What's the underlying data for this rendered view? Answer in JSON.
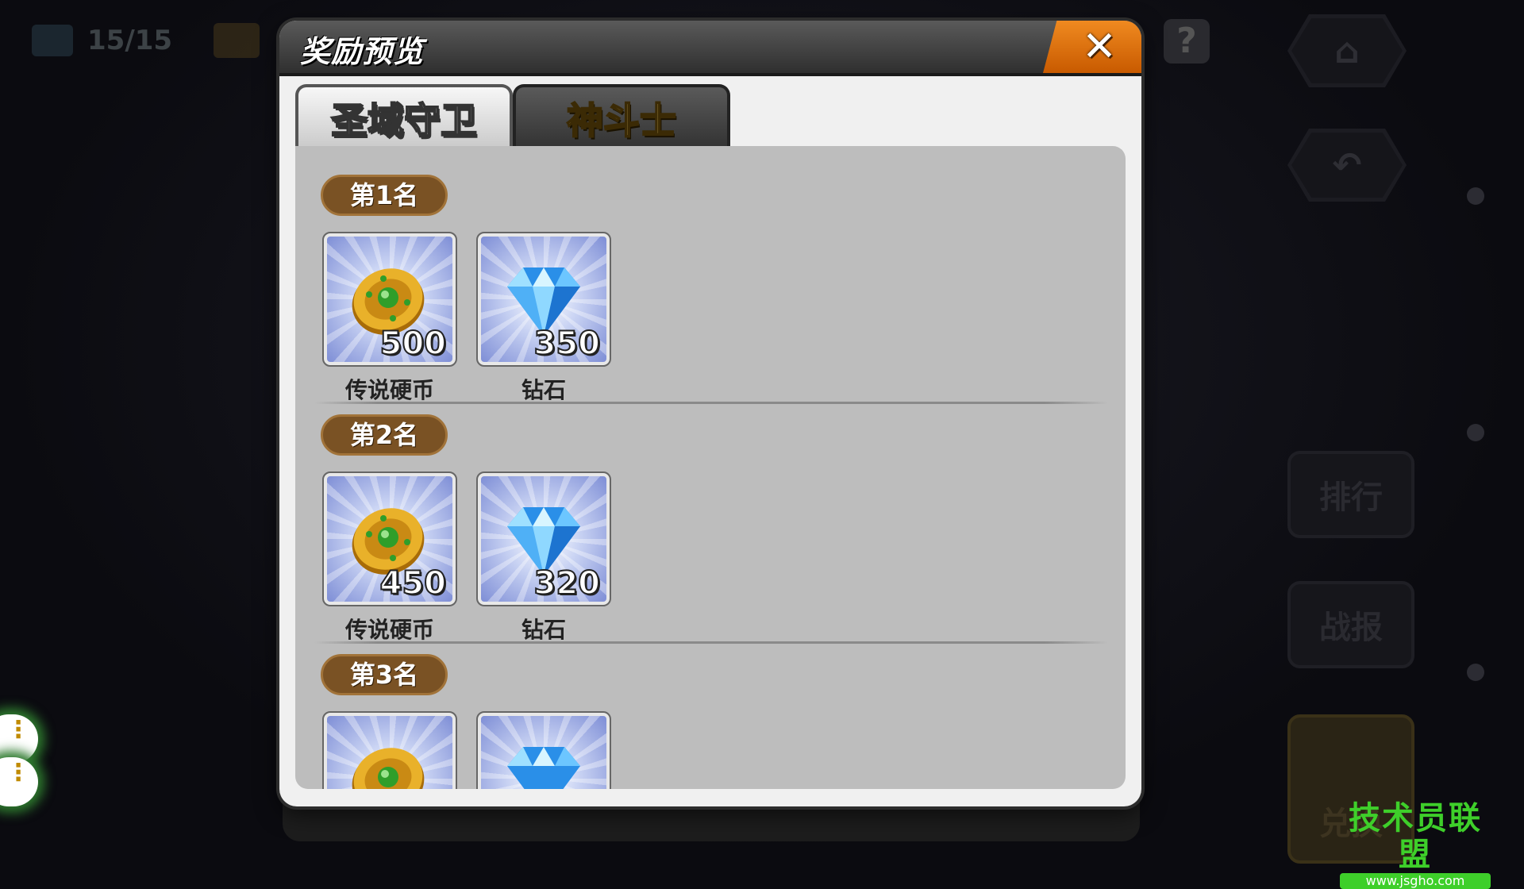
{
  "background": {
    "top_counter": "15/15",
    "help_icon_glyph": "?",
    "side_buttons": [
      "排行",
      "战报",
      "兑换"
    ]
  },
  "dialog": {
    "title": "奖励预览",
    "close_glyph": "✕",
    "tabs": [
      {
        "label": "圣域守卫",
        "active": true
      },
      {
        "label": "神斗士",
        "active": false
      }
    ],
    "ranks": [
      {
        "label": "第1名",
        "rewards": [
          {
            "icon": "legend-coin-icon",
            "quantity": "500",
            "name": "传说硬币"
          },
          {
            "icon": "diamond-icon",
            "quantity": "350",
            "name": "钻石"
          }
        ]
      },
      {
        "label": "第2名",
        "rewards": [
          {
            "icon": "legend-coin-icon",
            "quantity": "450",
            "name": "传说硬币"
          },
          {
            "icon": "diamond-icon",
            "quantity": "320",
            "name": "钻石"
          }
        ]
      },
      {
        "label": "第3名",
        "rewards": [
          {
            "icon": "legend-coin-icon",
            "quantity": "",
            "name": ""
          },
          {
            "icon": "diamond-icon",
            "quantity": "",
            "name": ""
          }
        ]
      }
    ]
  },
  "watermark": {
    "title": "技术员联盟",
    "url": "www.jsgho.com"
  },
  "colors": {
    "close_button": "#e07010",
    "rank_badge": "#7a5224",
    "content_bg": "#bdbdbd",
    "watermark_green": "#3ecf2a"
  }
}
